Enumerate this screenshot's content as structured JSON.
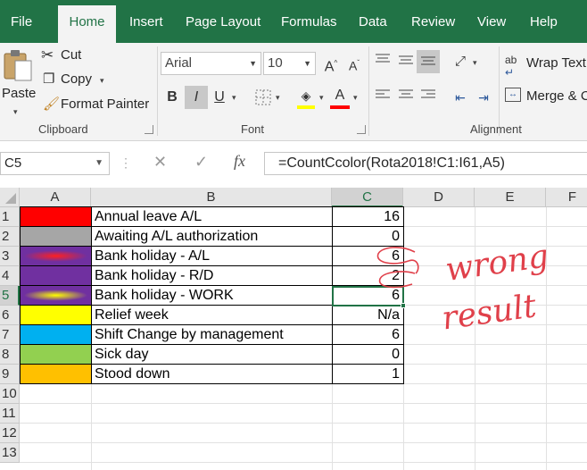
{
  "menu": {
    "tabs": [
      "File",
      "Home",
      "Insert",
      "Page Layout",
      "Formulas",
      "Data",
      "Review",
      "View",
      "Help"
    ],
    "active": "Home",
    "accent_color": "#217346"
  },
  "ribbon": {
    "clipboard": {
      "paste": "Paste",
      "cut": "Cut",
      "copy": "Copy",
      "format_painter": "Format Painter",
      "label": "Clipboard"
    },
    "font": {
      "name": "Arial",
      "size": "10",
      "bold": "B",
      "italic": "I",
      "underline": "U",
      "grow": "A",
      "shrink": "A",
      "font_color_letter": "A",
      "label": "Font",
      "fill_color": "#ffff00",
      "font_color": "#ff0000"
    },
    "alignment": {
      "wrap_text": "Wrap Text",
      "merge": "Merge & C",
      "label": "Alignment"
    }
  },
  "formula_bar": {
    "name_box": "C5",
    "fx": "fx",
    "formula": "=CountCcolor(Rota2018!C1:I61,A5)"
  },
  "sheet": {
    "columns": [
      "A",
      "B",
      "C",
      "D",
      "E",
      "F"
    ],
    "selected_column": "C",
    "rows": [
      "1",
      "2",
      "3",
      "4",
      "5",
      "6",
      "7",
      "8",
      "9",
      "10",
      "11",
      "12",
      "13"
    ],
    "selected_row": "5",
    "selected_cell": "C5",
    "data": [
      {
        "label": "Annual leave A/L",
        "value": "16",
        "color": "#ff0000",
        "pattern": "solid"
      },
      {
        "label": "Awaiting A/L authorization",
        "value": "0",
        "color": "#a6a6a6",
        "pattern": "solid"
      },
      {
        "label": "Bank holiday - A/L",
        "value": "6",
        "color": "#7030a0",
        "pattern": "red-center"
      },
      {
        "label": "Bank holiday - R/D",
        "value": "2",
        "color": "#7030a0",
        "pattern": "solid"
      },
      {
        "label": "Bank holiday - WORK",
        "value": "6",
        "color": "#7030a0",
        "pattern": "yellow-center"
      },
      {
        "label": "Relief week",
        "value": "N/a",
        "color": "#ffff00",
        "pattern": "solid"
      },
      {
        "label": "Shift Change by management",
        "value": "6",
        "color": "#00b0f0",
        "pattern": "solid"
      },
      {
        "label": "Sick day",
        "value": "0",
        "color": "#92d050",
        "pattern": "solid"
      },
      {
        "label": "Stood down",
        "value": "1",
        "color": "#ffc000",
        "pattern": "solid"
      }
    ]
  },
  "annotation": {
    "text_line1": "wrong",
    "text_line2": "result",
    "ink_color": "#e0404a"
  }
}
